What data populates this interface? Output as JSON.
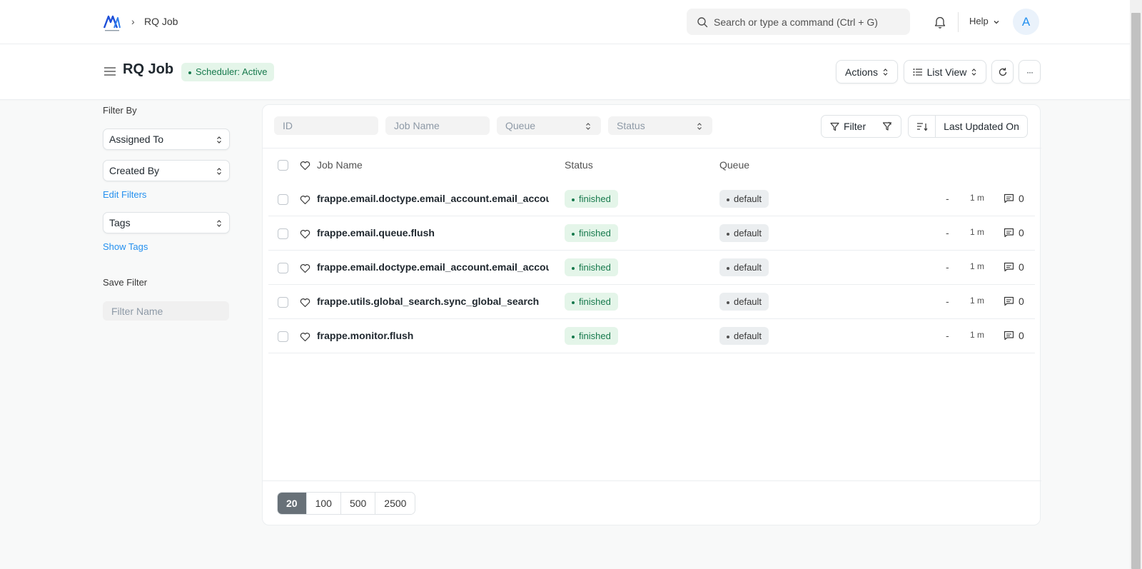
{
  "navbar": {
    "breadcrumb_sep": "›",
    "breadcrumb": "RQ Job",
    "search_placeholder": "Search or type a command (Ctrl + G)",
    "help_label": "Help",
    "avatar_initial": "A"
  },
  "page": {
    "title": "RQ Job",
    "scheduler_badge": "Scheduler: Active",
    "actions_label": "Actions",
    "list_view_label": "List View",
    "more_label": "···"
  },
  "sidebar": {
    "filter_by": "Filter By",
    "assigned_to": "Assigned To",
    "created_by": "Created By",
    "edit_filters": "Edit Filters",
    "tags": "Tags",
    "show_tags": "Show Tags",
    "save_filter": "Save Filter",
    "filter_name_placeholder": "Filter Name"
  },
  "filters": {
    "id_placeholder": "ID",
    "job_name_placeholder": "Job Name",
    "queue_label": "Queue",
    "status_label": "Status",
    "filter_label": "Filter",
    "sort_label": "Last Updated On"
  },
  "list": {
    "headers": {
      "job_name": "Job Name",
      "status": "Status",
      "queue": "Queue"
    },
    "rows": [
      {
        "name": "frappe.email.doctype.email_account.email_account.pull",
        "status": "finished",
        "queue": "default",
        "dash": "-",
        "time": "1 m",
        "comments": "0"
      },
      {
        "name": "frappe.email.queue.flush",
        "status": "finished",
        "queue": "default",
        "dash": "-",
        "time": "1 m",
        "comments": "0"
      },
      {
        "name": "frappe.email.doctype.email_account.email_account.notify",
        "status": "finished",
        "queue": "default",
        "dash": "-",
        "time": "1 m",
        "comments": "0"
      },
      {
        "name": "frappe.utils.global_search.sync_global_search",
        "status": "finished",
        "queue": "default",
        "dash": "-",
        "time": "1 m",
        "comments": "0"
      },
      {
        "name": "frappe.monitor.flush",
        "status": "finished",
        "queue": "default",
        "dash": "-",
        "time": "1 m",
        "comments": "0"
      }
    ]
  },
  "pager": [
    "20",
    "100",
    "500",
    "2500"
  ],
  "colors": {
    "accent": "#2490ef",
    "success_bg": "#e4f5e9",
    "success_text": "#16794c",
    "pager_active": "#687178"
  }
}
